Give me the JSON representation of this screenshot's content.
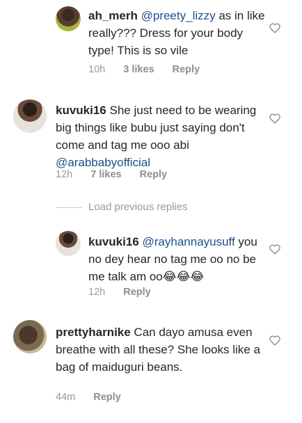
{
  "comments": [
    {
      "username": "ah_merh",
      "mention": "@preety_lizzy",
      "text": " as in like really??? Dress for your body type! This is so vile",
      "time": "10h",
      "likes": "3 likes",
      "reply": "Reply"
    },
    {
      "username": "kuvuki16",
      "text": " She just need to be wearing big things  like bubu just saying don't come and tag me ooo abi ",
      "mention": "@arabbabyofficial",
      "time": "12h",
      "likes": "7 likes",
      "reply": "Reply"
    },
    {
      "username": "kuvuki16",
      "mention": "@rayhannayusuff",
      "text": " you no dey hear no tag me oo no be me talk am oo😂😂😂",
      "time": "12h",
      "reply": "Reply"
    },
    {
      "username": "prettyharnike",
      "text": " Can dayo amusa even breathe with all these?  She looks like a bag of maiduguri beans.",
      "time": "44m",
      "reply": "Reply"
    }
  ],
  "load_previous": "Load previous replies",
  "colors": {
    "mention": "#1f4e8c",
    "meta": "#999999",
    "text": "#262626"
  },
  "icons": {
    "like": "heart-outline-icon"
  }
}
